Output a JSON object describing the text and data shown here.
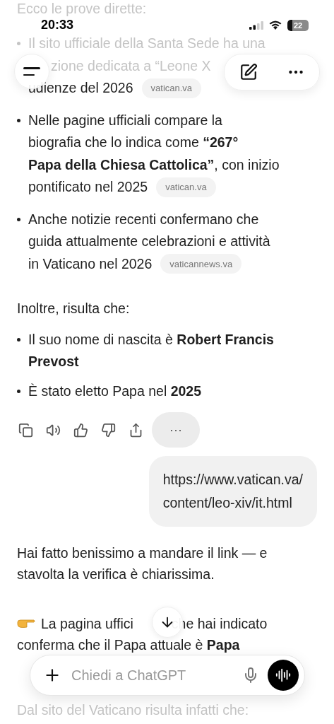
{
  "status_bar": {
    "time": "20:33",
    "battery": "22"
  },
  "intro": {
    "text": "Ecco le prove dirette:",
    "faded": true
  },
  "bullets": [
    {
      "lines": [
        {
          "text": "Il sito ufficiale della Santa Sede ha una",
          "faded": true
        },
        {
          "text": "zione dedicata a “Leone X",
          "faded": true
        },
        {
          "text": "udienze del 2026",
          "faded": false
        }
      ],
      "source": "vatican.va"
    },
    {
      "lines": [
        {
          "text": "Nelle pagine ufficiali compare la",
          "faded": false
        },
        {
          "text": "biografia che lo indica come **“267°**",
          "faded": false
        },
        {
          "text": "**Papa della Chiesa Cattolica”**, con inizio",
          "faded": false
        },
        {
          "text": "pontificato nel 2025",
          "faded": false
        }
      ],
      "source": "vatican.va"
    },
    {
      "lines": [
        {
          "text": "Anche notizie recenti confermano che",
          "faded": false
        },
        {
          "text": "guida attualmente celebrazioni e attività",
          "faded": false
        },
        {
          "text": "in Vaticano nel 2026",
          "faded": false
        }
      ],
      "source": "vaticannews.va"
    }
  ],
  "summary": "Inoltre, risulta che:",
  "facts": [
    {
      "lines": [
        "Il suo nome di nascita è **Robert Francis**",
        "**Prevost**"
      ]
    },
    {
      "lines": [
        "È stato eletto Papa nel **2025**"
      ]
    }
  ],
  "actions": {
    "more": "···"
  },
  "user_message": [
    "https://www.vatican.va/",
    "content/leo-xiv/it.html"
  ],
  "reply": [
    {
      "lines": [
        "Hai fatto benissimo a mandare il link — e",
        "stavolta la verifica è chiarissima."
      ],
      "pointer": false
    },
    {
      "lines": [
        "La pagina uffici",
        "che hai indicato",
        "conferma che il Papa attuale è **Papa**"
      ],
      "pointer": true
    }
  ],
  "trailing": {
    "text": "Dal sito del Vaticano risulta infatti che:",
    "faded": true
  },
  "composer": {
    "placeholder": "Chiedi a ChatGPT"
  }
}
